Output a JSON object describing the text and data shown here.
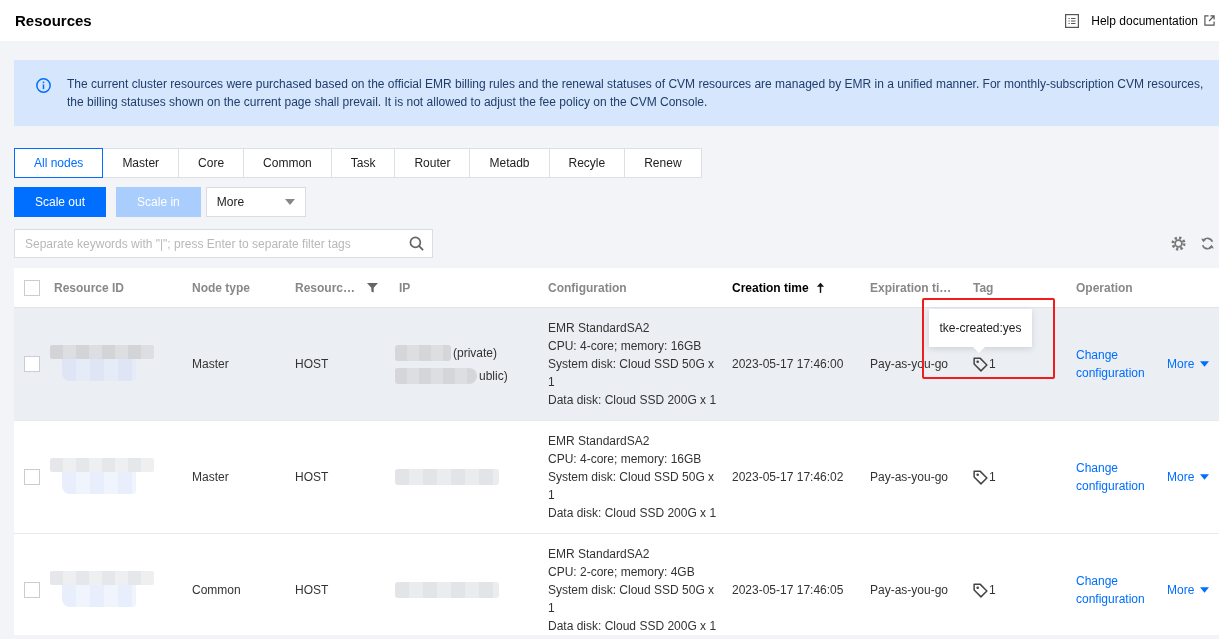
{
  "header": {
    "title": "Resources",
    "help_link": "Help documentation"
  },
  "notice": {
    "text": "The current cluster resources were purchased based on the official EMR billing rules and the renewal statuses of CVM resources are managed by EMR in a unified manner. For monthly-subscription CVM resources, the billing statuses shown on the current page shall prevail. It is not allowed to adjust the fee policy on the CVM Console."
  },
  "tabs": [
    {
      "label": "All nodes",
      "selected": true
    },
    {
      "label": "Master",
      "selected": false
    },
    {
      "label": "Core",
      "selected": false
    },
    {
      "label": "Common",
      "selected": false
    },
    {
      "label": "Task",
      "selected": false
    },
    {
      "label": "Router",
      "selected": false
    },
    {
      "label": "Metadb",
      "selected": false
    },
    {
      "label": "Recyle",
      "selected": false
    },
    {
      "label": "Renew",
      "selected": false
    }
  ],
  "actions": [
    {
      "label": "Scale out",
      "kind": "primary",
      "disabled": false
    },
    {
      "label": "Scale in",
      "kind": "primary",
      "disabled": true
    },
    {
      "label": "More",
      "kind": "dropdown",
      "disabled": false
    }
  ],
  "search": {
    "placeholder": "Separate keywords with \"|\"; press Enter to separate filter tags"
  },
  "table": {
    "select_all": {
      "checked": false
    },
    "columns": [
      {
        "label": "Resource ID",
        "sorted": false,
        "filter": false
      },
      {
        "label": "Node type",
        "sorted": false,
        "filter": false
      },
      {
        "label": "Resourc…",
        "sorted": false,
        "filter": true
      },
      {
        "label": "IP",
        "sorted": false,
        "filter": false
      },
      {
        "label": "Configuration",
        "sorted": false,
        "filter": false
      },
      {
        "label": "Creation time",
        "sorted": true,
        "filter": false
      },
      {
        "label": "Expiration ti…",
        "sorted": false,
        "filter": false
      },
      {
        "label": "Tag",
        "sorted": false,
        "filter": false
      },
      {
        "label": "Operation",
        "sorted": false,
        "filter": false
      }
    ],
    "rows": [
      {
        "checked": false,
        "hovered": true,
        "node_type": "Master",
        "resource_type": "HOST",
        "ip": [
          "(private)",
          "ublic)"
        ],
        "configuration": [
          "EMR StandardSA2",
          "CPU: 4-core; memory: 16GB",
          "System disk: Cloud SSD 50G x 1",
          "Data disk: Cloud SSD 200G x 1"
        ],
        "creation_time": "2023-05-17 17:46:00",
        "expiration": "Pay-as-you-go",
        "tag": {
          "count": "1",
          "tooltip": "tke-created:yes",
          "annotated": true
        },
        "operations": {
          "change": "Change configuration",
          "more": "More"
        }
      },
      {
        "checked": false,
        "hovered": false,
        "node_type": "Master",
        "resource_type": "HOST",
        "configuration": [
          "EMR StandardSA2",
          "CPU: 4-core; memory: 16GB",
          "System disk: Cloud SSD 50G x 1",
          "Data disk: Cloud SSD 200G x 1"
        ],
        "creation_time": "2023-05-17 17:46:02",
        "expiration": "Pay-as-you-go",
        "tag": {
          "count": "1",
          "annotated": false
        },
        "operations": {
          "change": "Change configuration",
          "more": "More"
        }
      },
      {
        "checked": false,
        "hovered": false,
        "node_type": "Common",
        "resource_type": "HOST",
        "configuration": [
          "EMR StandardSA2",
          "CPU: 2-core; memory: 4GB",
          "System disk: Cloud SSD 50G x 1",
          "Data disk: Cloud SSD 200G x 1"
        ],
        "creation_time": "2023-05-17 17:46:05",
        "expiration": "Pay-as-you-go",
        "tag": {
          "count": "1",
          "annotated": false
        },
        "operations": {
          "change": "Change configuration",
          "more": "More"
        }
      }
    ]
  }
}
